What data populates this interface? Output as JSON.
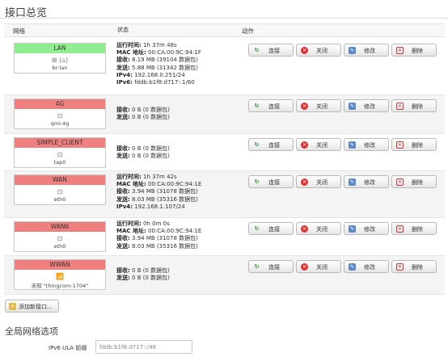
{
  "page": {
    "title": "接口总览",
    "columns": {
      "network": "网络",
      "status": "状态",
      "actions": "动作"
    }
  },
  "buttons": {
    "connect": "连接",
    "close": "关闭",
    "edit": "修改",
    "delete": "删除"
  },
  "colors": {
    "up": "#90ee90",
    "down": "#f08080"
  },
  "interfaces": [
    {
      "name": "LAN",
      "state": "up",
      "icon": "bridge-icon",
      "device": "br-lan",
      "lines": [
        {
          "k": "运行时间:",
          "v": " 1h 37m 48s"
        },
        {
          "k": "MAC 地址:",
          "v": " 00:CA:00:9C:94:1F"
        },
        {
          "k": "接收:",
          "v": " 8.19 MB (39104 数据包)"
        },
        {
          "k": "发送:",
          "v": " 5.88 MB (31342 数据包)"
        },
        {
          "k": "IPv4:",
          "v": " 192.168.0.251/24"
        },
        {
          "k": "IPv6:",
          "v": " fddb:b1f8:d717::1/60"
        }
      ]
    },
    {
      "name": "4G",
      "state": "down",
      "icon": "ethernet-port-icon",
      "device": "qmi-4g",
      "lines": [
        {
          "k": "接收:",
          "v": " 0 B (0 数据包)"
        },
        {
          "k": "发送:",
          "v": " 0 B (0 数据包)"
        }
      ]
    },
    {
      "name": "SIMPLE_CLIENT",
      "state": "down",
      "icon": "ethernet-port-icon",
      "device": "tap0",
      "lines": [
        {
          "k": "接收:",
          "v": " 0 B (0 数据包)"
        },
        {
          "k": "发送:",
          "v": " 0 B (0 数据包)"
        }
      ]
    },
    {
      "name": "WAN",
      "state": "down",
      "icon": "ethernet-port-icon",
      "device": "eth0",
      "lines": [
        {
          "k": "运行时间:",
          "v": " 1h 37m 42s"
        },
        {
          "k": "MAC 地址:",
          "v": " 00:CA:00:9C:94:1E"
        },
        {
          "k": "接收:",
          "v": " 3.94 MB (31078 数据包)"
        },
        {
          "k": "发送:",
          "v": " 8.03 MB (35316 数据包)"
        },
        {
          "k": "IPv4:",
          "v": " 192.168.1.107/24"
        }
      ]
    },
    {
      "name": "WAN6",
      "state": "down",
      "icon": "ethernet-port-icon",
      "device": "eth0",
      "lines": [
        {
          "k": "运行时间:",
          "v": " 0h 0m 0s"
        },
        {
          "k": "MAC 地址:",
          "v": " 00:CA:00:9C:94:1E"
        },
        {
          "k": "接收:",
          "v": " 3.94 MB (31078 数据包)"
        },
        {
          "k": "发送:",
          "v": " 8.03 MB (35316 数据包)"
        }
      ]
    },
    {
      "name": "WWAN",
      "state": "down",
      "icon": "wifi-icon",
      "device": "未知 \"thingcom-1704\"",
      "lines": [
        {
          "k": "接收:",
          "v": " 0 B (0 数据包)"
        },
        {
          "k": "发送:",
          "v": " 0 B (0 数据包)"
        }
      ]
    }
  ],
  "add_button": "添加新接口...",
  "global": {
    "title": "全局网络选项",
    "ula_label": "IPv6 ULA 前缀",
    "ula_value": "fddb:b1f8:d717::/48"
  }
}
